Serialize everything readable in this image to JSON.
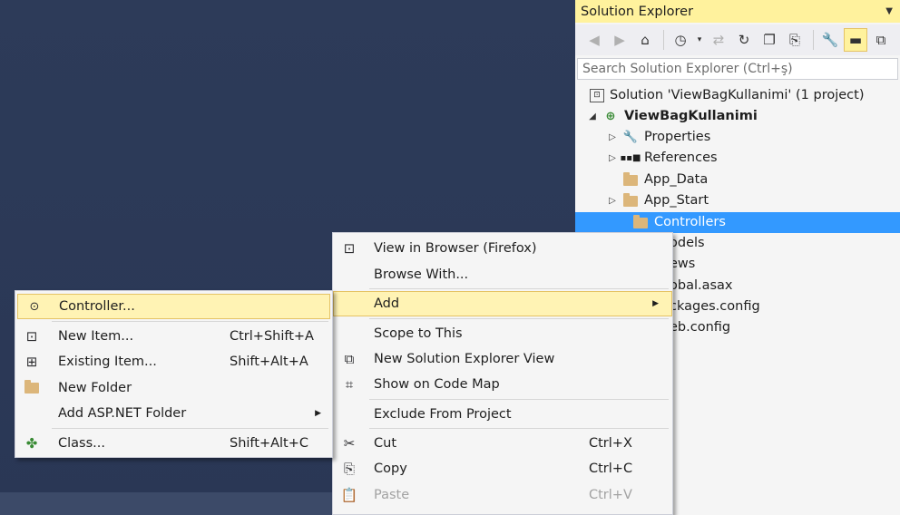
{
  "solution_explorer": {
    "title": "Solution Explorer",
    "search_placeholder": "Search Solution Explorer (Ctrl+ş)",
    "toolbar_icons": [
      "back-icon",
      "forward-icon",
      "home-icon",
      "history-icon",
      "dropdown-icon",
      "sync-icon",
      "refresh-icon",
      "collapse-all-icon",
      "copy-icon",
      "properties-icon",
      "minus-icon",
      "code-map-icon"
    ],
    "tree": [
      {
        "label": "Solution 'ViewBagKullanimi' (1 project)",
        "icon": "solution-icon",
        "expander": ""
      },
      {
        "label": "ViewBagKullanimi",
        "icon": "web-project-icon",
        "expander": "expanded"
      },
      {
        "label": "Properties",
        "icon": "wrench-icon",
        "expander": "collapsed"
      },
      {
        "label": "References",
        "icon": "references-icon",
        "expander": "collapsed"
      },
      {
        "label": "App_Data",
        "icon": "folder-icon",
        "expander": ""
      },
      {
        "label": "App_Start",
        "icon": "folder-icon",
        "expander": "collapsed"
      },
      {
        "label": "Controllers",
        "icon": "folder-icon",
        "expander": "",
        "selected": true
      },
      {
        "label": "odels",
        "icon": "",
        "expander": ""
      },
      {
        "label": "ews",
        "icon": "",
        "expander": ""
      },
      {
        "label": "obal.asax",
        "icon": "",
        "expander": ""
      },
      {
        "label": "ckages.config",
        "icon": "",
        "expander": ""
      },
      {
        "label": "eb.config",
        "icon": "",
        "expander": ""
      }
    ]
  },
  "context_menu": {
    "items": [
      {
        "label": "View in Browser (Firefox)",
        "shortcut": "",
        "icon": "browser-icon"
      },
      {
        "label": "Browse With...",
        "shortcut": "",
        "icon": ""
      },
      {
        "label": "Add",
        "shortcut": "",
        "icon": "",
        "submenu": true,
        "highlighted": true
      },
      {
        "label": "Scope to This",
        "shortcut": "",
        "icon": ""
      },
      {
        "label": "New Solution Explorer View",
        "shortcut": "",
        "icon": "new-view-icon"
      },
      {
        "label": "Show on Code Map",
        "shortcut": "",
        "icon": "code-map-icon"
      },
      {
        "label": "Exclude From Project",
        "shortcut": "",
        "icon": ""
      },
      {
        "label": "Cut",
        "shortcut": "Ctrl+X",
        "icon": "scissors-icon"
      },
      {
        "label": "Copy",
        "shortcut": "Ctrl+C",
        "icon": "copy-icon"
      },
      {
        "label": "Paste",
        "shortcut": "Ctrl+V",
        "icon": "paste-icon",
        "disabled": true
      }
    ]
  },
  "add_submenu": {
    "items": [
      {
        "label": "Controller...",
        "shortcut": "",
        "icon": "controller-icon",
        "highlighted": true
      },
      {
        "label": "New Item...",
        "shortcut": "Ctrl+Shift+A",
        "icon": "new-item-icon"
      },
      {
        "label": "Existing Item...",
        "shortcut": "Shift+Alt+A",
        "icon": "existing-item-icon"
      },
      {
        "label": "New Folder",
        "shortcut": "",
        "icon": "new-folder-icon"
      },
      {
        "label": "Add ASP.NET Folder",
        "shortcut": "",
        "icon": "",
        "submenu": true
      },
      {
        "label": "Class...",
        "shortcut": "Shift+Alt+C",
        "icon": "class-icon"
      }
    ]
  },
  "colors": {
    "editor_background": "#2d3b59",
    "title_highlight": "#fff29d",
    "selection": "#3399ff",
    "menu_highlight": "#fff3b4"
  }
}
